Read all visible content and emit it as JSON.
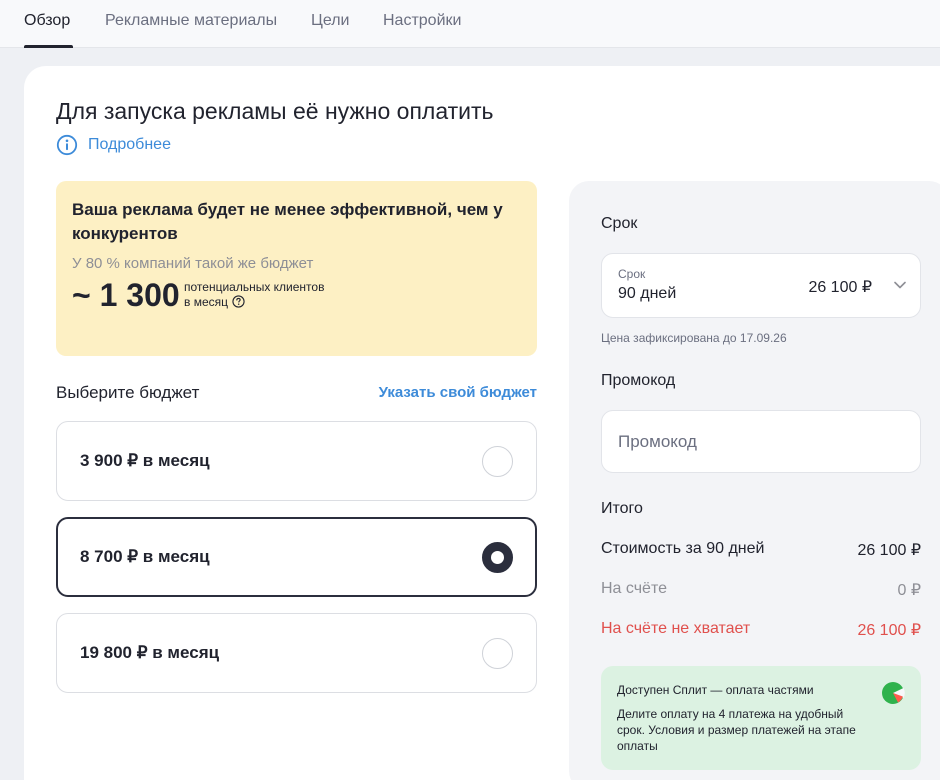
{
  "tabs": [
    {
      "label": "Обзор",
      "active": true
    },
    {
      "label": "Рекламные материалы",
      "active": false
    },
    {
      "label": "Цели",
      "active": false
    },
    {
      "label": "Настройки",
      "active": false
    }
  ],
  "main": {
    "title": "Для запуска рекламы её нужно оплатить",
    "more_link": "Подробнее",
    "promo": {
      "headline": "Ваша реклама будет не менее эффективной, чем у конкурентов",
      "subtext": "У 80 % компаний такой же бюджет",
      "number": "~ 1 300",
      "note_line1": "потенциальных клиентов",
      "note_line2": "в месяц"
    },
    "budget": {
      "label": "Выберите бюджет",
      "custom_link": "Указать свой бюджет",
      "options": [
        {
          "label": "3 900 ₽ в месяц",
          "selected": false
        },
        {
          "label": "8 700 ₽ в месяц",
          "selected": true
        },
        {
          "label": "19 800 ₽ в месяц",
          "selected": false
        }
      ]
    }
  },
  "side": {
    "term_title": "Срок",
    "term_select": {
      "small_label": "Срок",
      "value": "90 дней",
      "price": "26 100 ₽"
    },
    "price_fixed_note": "Цена зафиксирована до 17.09.26",
    "promo_title": "Промокод",
    "promo_placeholder": "Промокод",
    "total_title": "Итого",
    "rows": [
      {
        "label": "Стоимость за 90 дней",
        "value": "26 100 ₽",
        "style": "normal"
      },
      {
        "label": "На счёте",
        "value": "0 ₽",
        "style": "muted"
      },
      {
        "label": "На счёте не хватает",
        "value": "26 100 ₽",
        "style": "warn"
      }
    ],
    "split": {
      "title": "Доступен Сплит — оплата частями",
      "text": "Делите оплату на 4 платежа на удобный срок. Условия и размер платежей на этапе оплаты"
    }
  },
  "colors": {
    "accent_link": "#3d8bd9",
    "promo_bg": "#fdf0c4",
    "warning": "#e0504d",
    "split_bg": "#dcf2e2",
    "selected_border": "#2b2e3d"
  },
  "icons": {
    "info": "info-circle-icon",
    "question": "question-circle-icon",
    "chevron": "chevron-down-icon",
    "split_logo": "split-logo-icon"
  }
}
